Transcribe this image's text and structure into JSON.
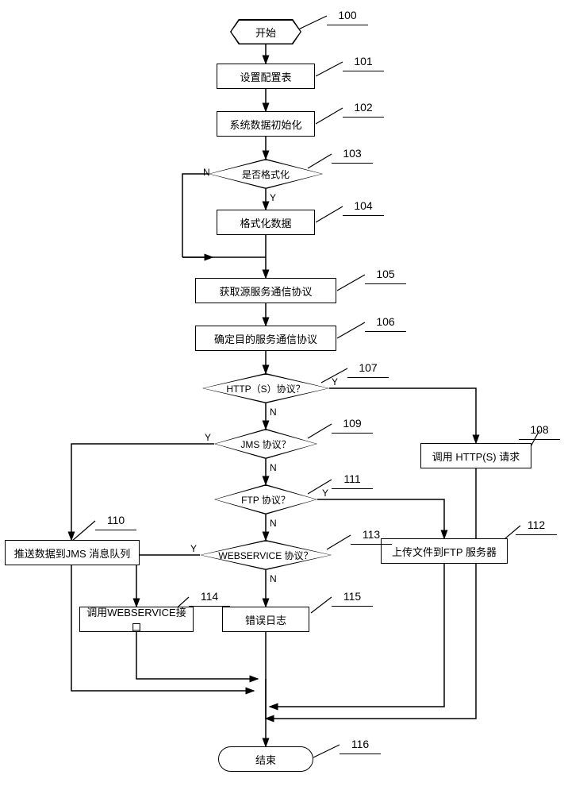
{
  "chart_data": {
    "type": "flowchart",
    "nodes": [
      {
        "id": "100",
        "shape": "hexagon",
        "label": "开始"
      },
      {
        "id": "101",
        "shape": "process",
        "label": "设置配置表"
      },
      {
        "id": "102",
        "shape": "process",
        "label": "系统数据初始化"
      },
      {
        "id": "103",
        "shape": "decision",
        "label": "是否格式化"
      },
      {
        "id": "104",
        "shape": "process",
        "label": "格式化数据"
      },
      {
        "id": "105",
        "shape": "process",
        "label": "获取源服务通信协议"
      },
      {
        "id": "106",
        "shape": "process",
        "label": "确定目的服务通信协议"
      },
      {
        "id": "107",
        "shape": "decision",
        "label": "HTTP（S）协议？"
      },
      {
        "id": "108",
        "shape": "process",
        "label": "调用 HTTP(S) 请求"
      },
      {
        "id": "109",
        "shape": "decision",
        "label": "JMS 协议？"
      },
      {
        "id": "110",
        "shape": "process",
        "label": "推送数据到JMS 消息队列"
      },
      {
        "id": "111",
        "shape": "decision",
        "label": "FTP 协议？"
      },
      {
        "id": "112",
        "shape": "process",
        "label": "上传文件到FTP 服务器"
      },
      {
        "id": "113",
        "shape": "decision",
        "label": "WEBSERVICE 协议？"
      },
      {
        "id": "114",
        "shape": "process",
        "label": "调用WEBSERVICE接口"
      },
      {
        "id": "115",
        "shape": "process",
        "label": "错误日志"
      },
      {
        "id": "116",
        "shape": "terminator",
        "label": "结束"
      }
    ],
    "edges": [
      {
        "from": "100",
        "to": "101"
      },
      {
        "from": "101",
        "to": "102"
      },
      {
        "from": "102",
        "to": "103"
      },
      {
        "from": "103",
        "to": "104",
        "label": "Y"
      },
      {
        "from": "103",
        "to": "105",
        "label": "N"
      },
      {
        "from": "104",
        "to": "105"
      },
      {
        "from": "105",
        "to": "106"
      },
      {
        "from": "106",
        "to": "107"
      },
      {
        "from": "107",
        "to": "108",
        "label": "Y"
      },
      {
        "from": "107",
        "to": "109",
        "label": "N"
      },
      {
        "from": "109",
        "to": "110",
        "label": "Y"
      },
      {
        "from": "109",
        "to": "111",
        "label": "N"
      },
      {
        "from": "111",
        "to": "112",
        "label": "Y"
      },
      {
        "from": "111",
        "to": "113",
        "label": "N"
      },
      {
        "from": "113",
        "to": "114",
        "label": "Y"
      },
      {
        "from": "113",
        "to": "115",
        "label": "N"
      },
      {
        "from": "108",
        "to": "116"
      },
      {
        "from": "110",
        "to": "116"
      },
      {
        "from": "112",
        "to": "116"
      },
      {
        "from": "114",
        "to": "116"
      },
      {
        "from": "115",
        "to": "116"
      }
    ]
  },
  "labels": {
    "n100": "开始",
    "n101": "设置配置表",
    "n102": "系统数据初始化",
    "n103": "是否格式化",
    "n104": "格式化数据",
    "n105": "获取源服务通信协议",
    "n106": "确定目的服务通信协议",
    "n107": "HTTP（S）协议？",
    "n108": "调用 HTTP(S) 请求",
    "n109": "JMS 协议？",
    "n110": "推送数据到JMS 消息队列",
    "n111": "FTP 协议？",
    "n112": "上传文件到FTP 服务器",
    "n113": "WEBSERVICE 协议？",
    "n114": "调用WEBSERVICE接口",
    "n115": "错误日志",
    "n116": "结束"
  },
  "callouts": {
    "c100": "100",
    "c101": "101",
    "c102": "102",
    "c103": "103",
    "c104": "104",
    "c105": "105",
    "c106": "106",
    "c107": "107",
    "c108": "108",
    "c109": "109",
    "c110": "110",
    "c111": "111",
    "c112": "112",
    "c113": "113",
    "c114": "114",
    "c115": "115",
    "c116": "116"
  },
  "yn": {
    "y": "Y",
    "n": "N"
  }
}
